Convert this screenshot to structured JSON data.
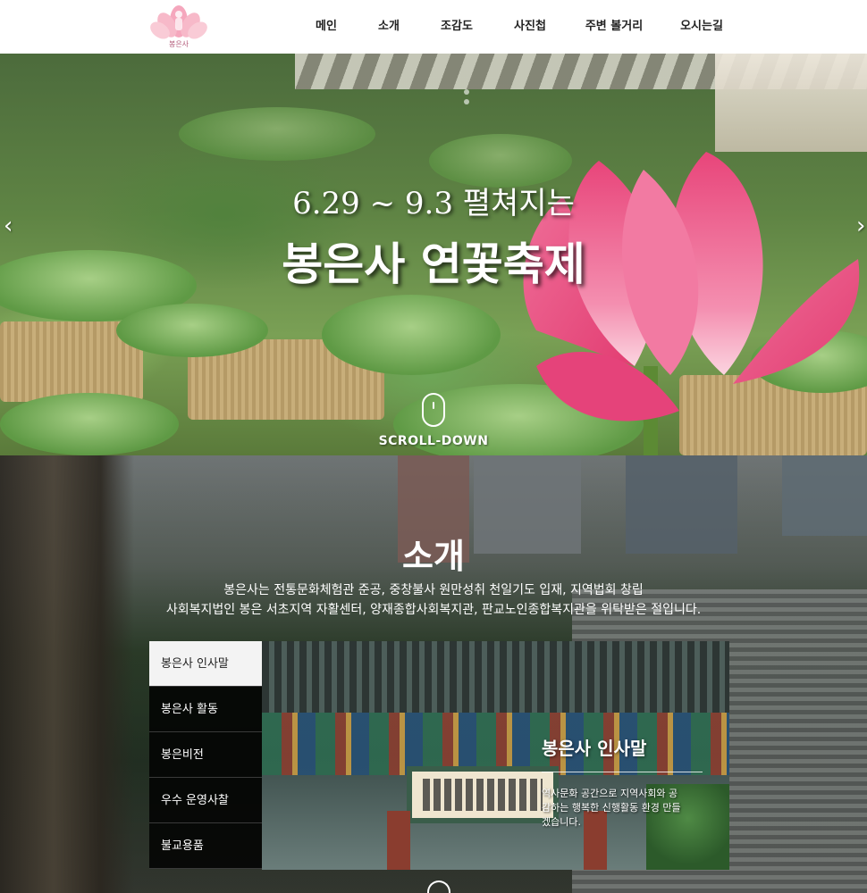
{
  "header": {
    "logo_text": "봉은사",
    "nav": [
      "메인",
      "소개",
      "조감도",
      "사진첩",
      "주변 볼거리",
      "오시는길"
    ]
  },
  "hero": {
    "subtitle": "6.29 ~ 9.3 펼쳐지는",
    "title": "봉은사 연꽃축제",
    "prev_arrow": "‹",
    "next_arrow": "›",
    "scroll_label": "SCROLL-DOWN"
  },
  "intro": {
    "title": "소개",
    "desc_line1": "봉은사는 전통문화체험관 준공, 중창불사 원만성취 천일기도 입재, 지역법회 창립",
    "desc_line2": "사회복지법인 봉은 서초지역 자활센터, 양재종합사회복지관, 판교노인종합복지관을 위탁받은 절입니다.",
    "tabs": [
      "봉은사 인사말",
      "봉은사 활동",
      "봉은비전",
      "우수 운영사찰",
      "불교용품"
    ],
    "active_tab": 0,
    "panel": {
      "title": "봉은사 인사말",
      "text": "역사문화 공간으로 지역사회와 공감하는 행복한 신행활동 환경 만들겠습니다."
    }
  },
  "colors": {
    "lotus_pink": "#e8457a",
    "header_bg": "#ffffff",
    "tab_active_bg": "#f3f3f3",
    "tab_bg": "#111111"
  }
}
